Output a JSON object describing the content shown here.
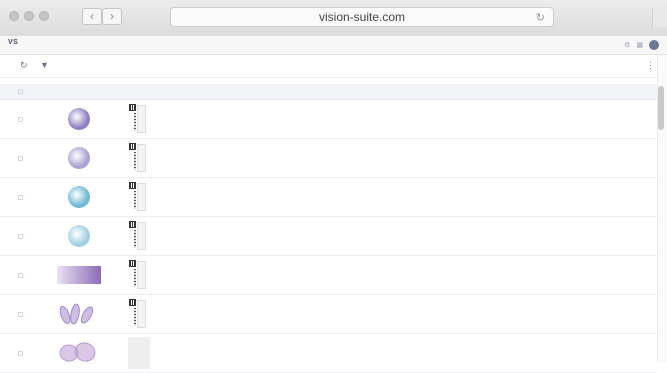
{
  "browser": {
    "url": "vision-suite.com",
    "back_glyph": "‹",
    "forward_glyph": "›",
    "reload_glyph": "↻"
  },
  "app_header": {
    "logo_text": "VS",
    "logo_sub": "",
    "breadcrumb": "",
    "right_link": "",
    "icons": [
      "settings-icon",
      "grid-icon",
      "user-avatar"
    ]
  },
  "toolbar": {
    "refresh_glyph": "↻",
    "filter_glyph": "▼",
    "menu_glyph": "⋮"
  },
  "table": {
    "columns": [
      "",
      "",
      "",
      "",
      "",
      "",
      "",
      "",
      ""
    ],
    "rows": [
      {
        "thumb": "circle",
        "color": "#8e7fc2",
        "flag": "",
        "date": "",
        "id": "",
        "type": "",
        "size": ""
      },
      {
        "thumb": "circle",
        "color": "#a7a2d3",
        "flag": "",
        "date": "",
        "id": "",
        "type": "",
        "size": ""
      },
      {
        "thumb": "circle",
        "color": "#6fb8d6",
        "flag": "",
        "date": "",
        "id": "",
        "type": "",
        "size": ""
      },
      {
        "thumb": "circle",
        "color": "#9fd0e2",
        "flag": "",
        "date": "",
        "id": "",
        "type": "",
        "size": ""
      },
      {
        "thumb": "slide",
        "color": "#8b6bb6",
        "flag": "",
        "date": "",
        "id": "",
        "type": "",
        "size": ""
      },
      {
        "thumb": "tissue",
        "color": "#a28ac9",
        "flag": "",
        "date": "",
        "id": "",
        "type": "",
        "size": ""
      },
      {
        "thumb": "tissue2",
        "color": "#b89bd2",
        "flag": "",
        "date": "",
        "id": "",
        "type": "",
        "size": ""
      }
    ]
  }
}
